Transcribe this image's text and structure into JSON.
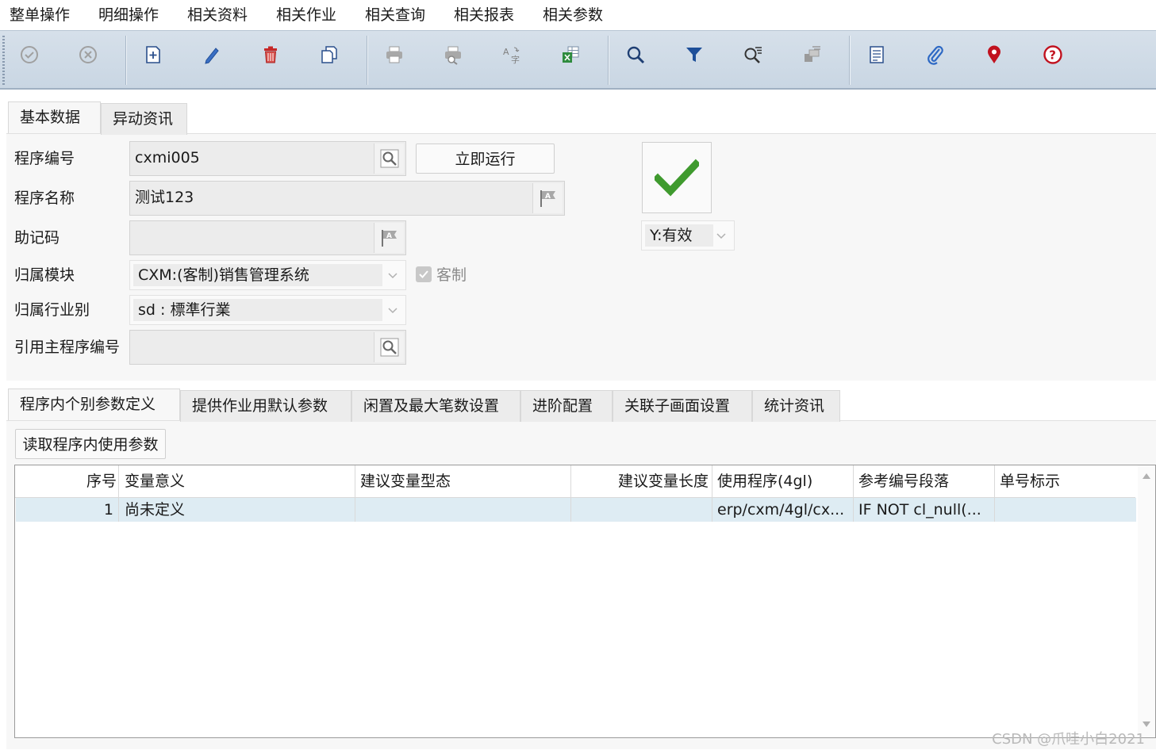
{
  "menu": [
    "整单操作",
    "明细操作",
    "相关资料",
    "相关作业",
    "相关查询",
    "相关报表",
    "相关参数"
  ],
  "toolbar": {
    "icons": [
      "confirm-icon",
      "cancel-icon",
      "new-icon",
      "edit-icon",
      "delete-icon",
      "copy-icon",
      "print-icon",
      "print-preview-icon",
      "translate-icon",
      "export-excel-icon",
      "search-icon",
      "filter-icon",
      "query-icon",
      "stack-icon",
      "document-icon",
      "attachment-icon",
      "location-pin-icon",
      "help-icon"
    ]
  },
  "top_tabs": [
    "基本数据",
    "异动资讯"
  ],
  "form": {
    "program_no_label": "程序编号",
    "program_no_value": "cxmi005",
    "run_button": "立即运行",
    "program_name_label": "程序名称",
    "program_name_value": "测试123",
    "mnemonic_label": "助记码",
    "mnemonic_value": "",
    "module_label": "归属模块",
    "module_value": "CXM:(客制)销售管理系统",
    "custom_label": "客制",
    "industry_label": "归属行业别",
    "industry_value": "sd : 標準行業",
    "ref_program_label": "引用主程序编号",
    "ref_program_value": "",
    "status_value": "Y:有效"
  },
  "sub_tabs": [
    "程序内个别参数定义",
    "提供作业用默认参数",
    "闲置及最大笔数设置",
    "进阶配置",
    "关联子画面设置",
    "统计资讯"
  ],
  "read_params_button": "读取程序内使用参数",
  "grid": {
    "headers": [
      "序号",
      "变量意义",
      "建议变量型态",
      "建议变量长度",
      "使用程序(4gl)",
      "参考编号段落",
      "单号标示"
    ],
    "rows": [
      [
        "1",
        "尚未定义",
        "",
        "",
        "erp/cxm/4gl/cx...",
        "IF NOT cl_null(...",
        ""
      ]
    ]
  },
  "watermark": "CSDN @爪哇小白2021",
  "colors": {
    "toolbar_bg": "#c9d6e3",
    "selected_row": "#deecf3",
    "valid_check": "#3f9a2e"
  }
}
